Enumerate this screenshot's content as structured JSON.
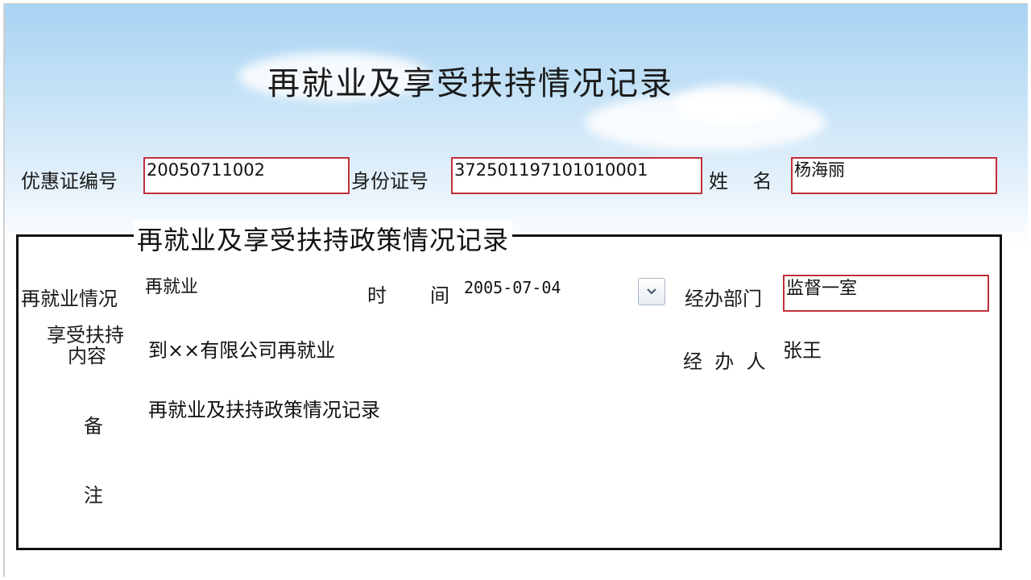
{
  "window": {
    "title": "再就业及享受扶持情况记录"
  },
  "header": {
    "certificate_label": "优惠证编号",
    "certificate_value": "20050711002",
    "id_label": "身份证号",
    "id_value": "372501197101010001",
    "name_label": "姓    名",
    "name_value": "杨海丽"
  },
  "section": {
    "legend": "再就业及享受扶持政策情况记录",
    "reemployment_label": "再就业情况",
    "reemployment_value": "再就业",
    "time_label_1": "时",
    "time_label_2": "间",
    "time_value": "2005-07-04",
    "dept_label": "经办部门",
    "dept_value": "监督一室",
    "support_label_1": "享受扶持",
    "support_label_2": "内容",
    "support_value": "到××有限公司再就业",
    "handler_label": "经  办  人",
    "handler_value": "张王",
    "remark_label_1": "备",
    "remark_label_2": "注",
    "remark_value": "再就业及扶持政策情况记录"
  },
  "icons": {
    "dropdown": "chevron-down-icon"
  },
  "colors": {
    "field_border": "#c0303a",
    "sky_top": "#a9d3f2"
  }
}
